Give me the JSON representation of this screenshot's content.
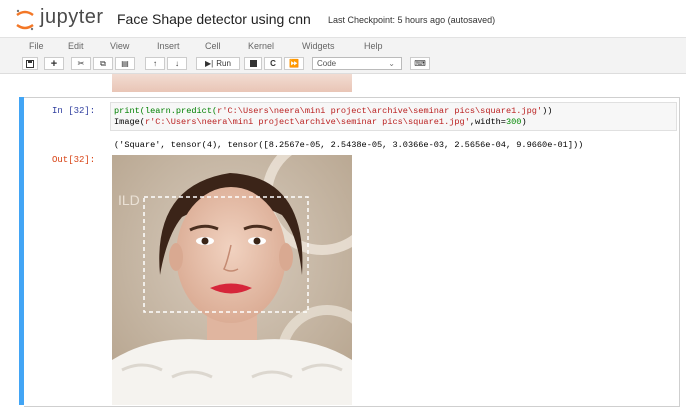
{
  "header": {
    "logo_text": "jupyter",
    "notebook_title": "Face Shape detector using cnn",
    "checkpoint_status": "Last Checkpoint: 5 hours ago  (autosaved)"
  },
  "menu": [
    "File",
    "Edit",
    "View",
    "Insert",
    "Cell",
    "Kernel",
    "Widgets",
    "Help"
  ],
  "toolbar": {
    "run_label": "Run",
    "cell_type": "Code"
  },
  "cell": {
    "in_prompt": "In [32]:",
    "out_prompt": "Out[32]:",
    "code_line1_fn": "print(learn.predict(",
    "code_line1_str": "r'C:\\Users\\neera\\mini project\\archive\\seminar pics\\square1.jpg'",
    "code_line1_end": "))",
    "code_line2_fn": "Image(",
    "code_line2_str": "r'C:\\Users\\neera\\mini project\\archive\\seminar pics\\square1.jpg'",
    "code_line2_mid": ",width=",
    "code_line2_num": "300",
    "code_line2_end": ")",
    "output_text": "('Square', tensor(4), tensor([8.2567e-05, 2.5438e-05, 3.0366e-03, 2.5656e-04, 9.9660e-01]))"
  },
  "colors": {
    "accent_bar": "#42a5f5",
    "in_prompt": "#303f9f",
    "out_prompt": "#d84315"
  }
}
